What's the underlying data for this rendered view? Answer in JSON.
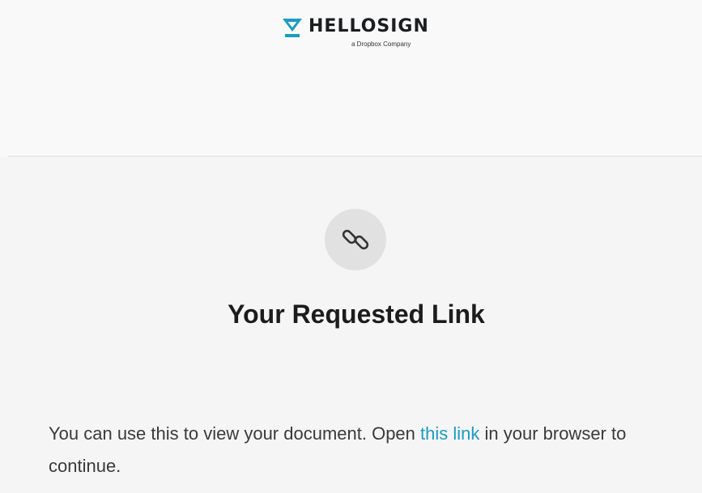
{
  "header": {
    "brand_name": "HELLOSIGN",
    "brand_tagline": "a Dropbox Company",
    "logo_icon": "hellosign-logo-icon",
    "accent_color": "#1a9cc4"
  },
  "main": {
    "icon": "link-icon",
    "title": "Your Requested Link",
    "body_before_link": "You can use this to view your document. Open ",
    "link_text": "this link",
    "body_after_link": " in your browser to continue.",
    "link_color": "#1a9cc4"
  }
}
